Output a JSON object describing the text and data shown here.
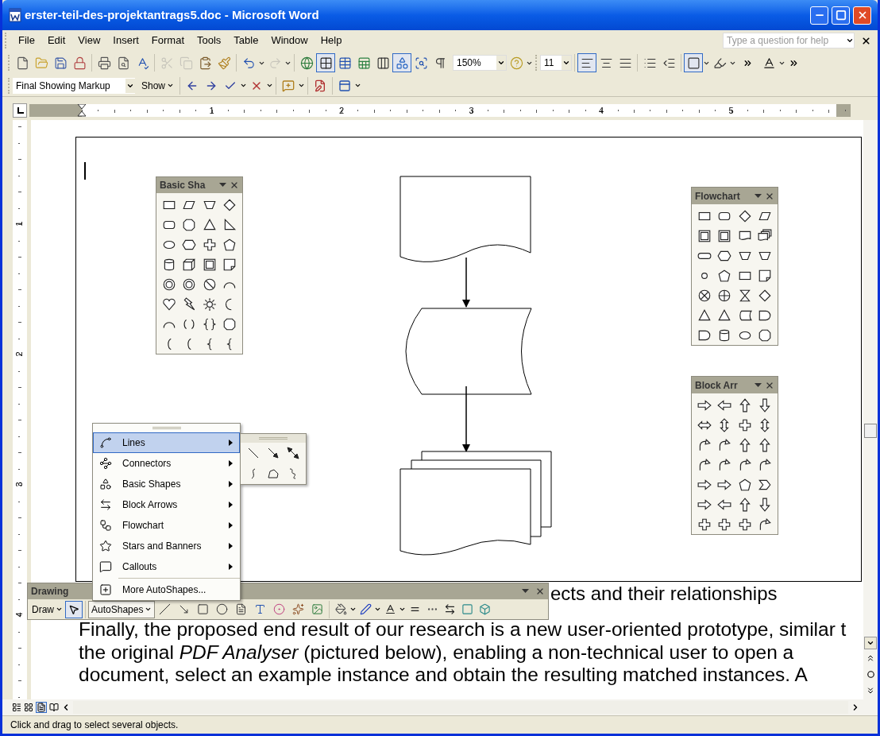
{
  "window": {
    "title": "erster-teil-des-projektantrags5.doc - Microsoft Word"
  },
  "menu": [
    "File",
    "Edit",
    "View",
    "Insert",
    "Format",
    "Tools",
    "Table",
    "Window",
    "Help"
  ],
  "help_box": {
    "placeholder": "Type a question for help"
  },
  "standard_toolbar": {
    "buttons": [
      {
        "pressed": false,
        "disabled": false
      },
      {
        "pressed": false,
        "disabled": false
      },
      {
        "pressed": false,
        "disabled": false
      },
      {
        "pressed": false,
        "disabled": false
      },
      {
        "pressed": false,
        "disabled": false
      },
      {
        "pressed": false,
        "disabled": false
      },
      {
        "pressed": false,
        "disabled": false
      },
      {
        "pressed": false,
        "disabled": true
      },
      {
        "pressed": false,
        "disabled": true
      },
      {
        "pressed": false,
        "disabled": false
      },
      {
        "pressed": false,
        "disabled": false
      },
      {
        "pressed": false,
        "disabled": false
      },
      {
        "pressed": false,
        "disabled": true
      },
      {
        "pressed": false,
        "disabled": false
      },
      {
        "pressed": true,
        "disabled": false
      },
      {
        "pressed": false,
        "disabled": false
      },
      {
        "pressed": false,
        "disabled": false
      },
      {
        "pressed": false,
        "disabled": false
      },
      {
        "pressed": true,
        "disabled": false
      },
      {
        "pressed": false,
        "disabled": false
      },
      {
        "pressed": false,
        "disabled": false
      }
    ],
    "zoom": "150%",
    "font_size": "11",
    "format_buttons": [
      {
        "pressed": false,
        "disabled": false
      },
      {
        "pressed": true,
        "disabled": false
      },
      {
        "pressed": false,
        "disabled": false
      },
      {
        "pressed": false,
        "disabled": false
      },
      {
        "pressed": false,
        "disabled": false
      },
      {
        "pressed": false,
        "disabled": false
      },
      {
        "pressed": true,
        "disabled": false
      },
      {
        "pressed": false,
        "disabled": false
      },
      {
        "pressed": false,
        "disabled": false
      }
    ]
  },
  "reviewing_toolbar": {
    "display": "Final Showing Markup",
    "show": "Show"
  },
  "ruler": {
    "marks": [
      "1",
      "2",
      "3",
      "4",
      "5"
    ]
  },
  "vertical_ruler": {
    "marks": [
      "1",
      "2",
      "3",
      "4"
    ]
  },
  "palettes": [
    {
      "title": "Basic Sha"
    },
    {
      "title": "Flowchart"
    },
    {
      "title": "Block Arr"
    }
  ],
  "autoshapes_menu": {
    "items": [
      {
        "label": "Lines",
        "selected": true,
        "submenu": true
      },
      {
        "label": "Connectors",
        "selected": false,
        "submenu": true
      },
      {
        "label": "Basic Shapes",
        "selected": false,
        "submenu": true
      },
      {
        "label": "Block Arrows",
        "selected": false,
        "submenu": true
      },
      {
        "label": "Flowchart",
        "selected": false,
        "submenu": true
      },
      {
        "label": "Stars and Banners",
        "selected": false,
        "submenu": true
      },
      {
        "label": "Callouts",
        "selected": false,
        "submenu": true
      },
      {
        "label": "More AutoShapes...",
        "selected": false,
        "submenu": false
      }
    ]
  },
  "drawing_toolbar": {
    "title": "Drawing",
    "draw": "Draw",
    "select_pressed": true,
    "autoshapes": "AutoShapes",
    "autoshapes_open": true
  },
  "document": {
    "fragment": "ects and their relationships",
    "paragraph": [
      "Finally, the proposed end result of our research is a new user-oriented prototype, similar t",
      "the original *PDF Analyser* (pictured below), enabling a non-technical user to open a",
      "document, select an example instance and obtain the resulting matched instances.  A"
    ]
  },
  "status_bar": "Click and drag to select several objects."
}
